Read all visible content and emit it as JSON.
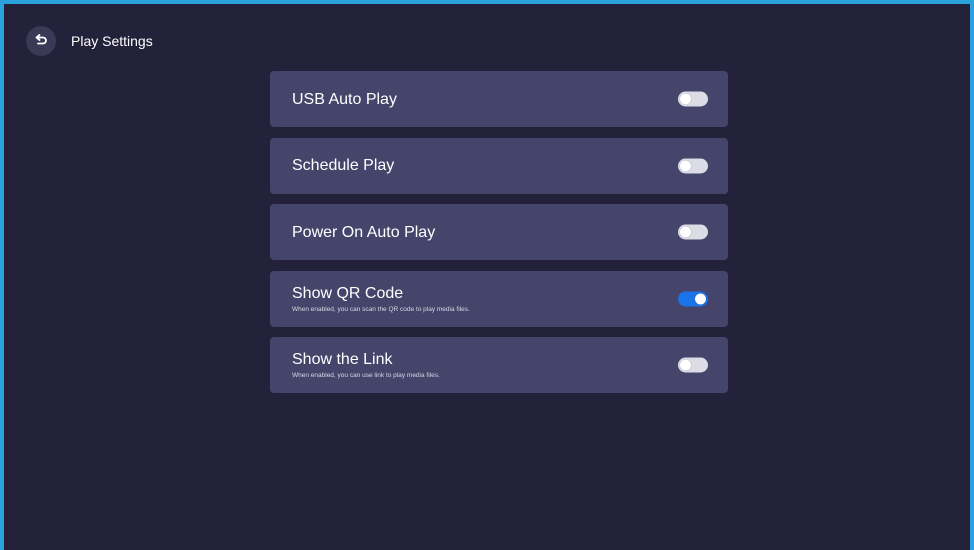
{
  "header": {
    "back_icon": "back-arrow-icon",
    "title": "Play Settings"
  },
  "colors": {
    "background": "#23223a",
    "card": "#45446a",
    "toggle_on": "#1a73e8",
    "toggle_off": "#dcdce6",
    "frame_border": "#2aa3dc"
  },
  "settings": [
    {
      "label": "USB Auto Play",
      "description": "",
      "enabled": false
    },
    {
      "label": "Schedule Play",
      "description": "",
      "enabled": false
    },
    {
      "label": "Power On Auto Play",
      "description": "",
      "enabled": false
    },
    {
      "label": "Show QR Code",
      "description": "When enabled, you can scan the QR code to play media files.",
      "enabled": true
    },
    {
      "label": "Show the Link",
      "description": "When enabled, you can use link to play media files.",
      "enabled": false
    }
  ]
}
